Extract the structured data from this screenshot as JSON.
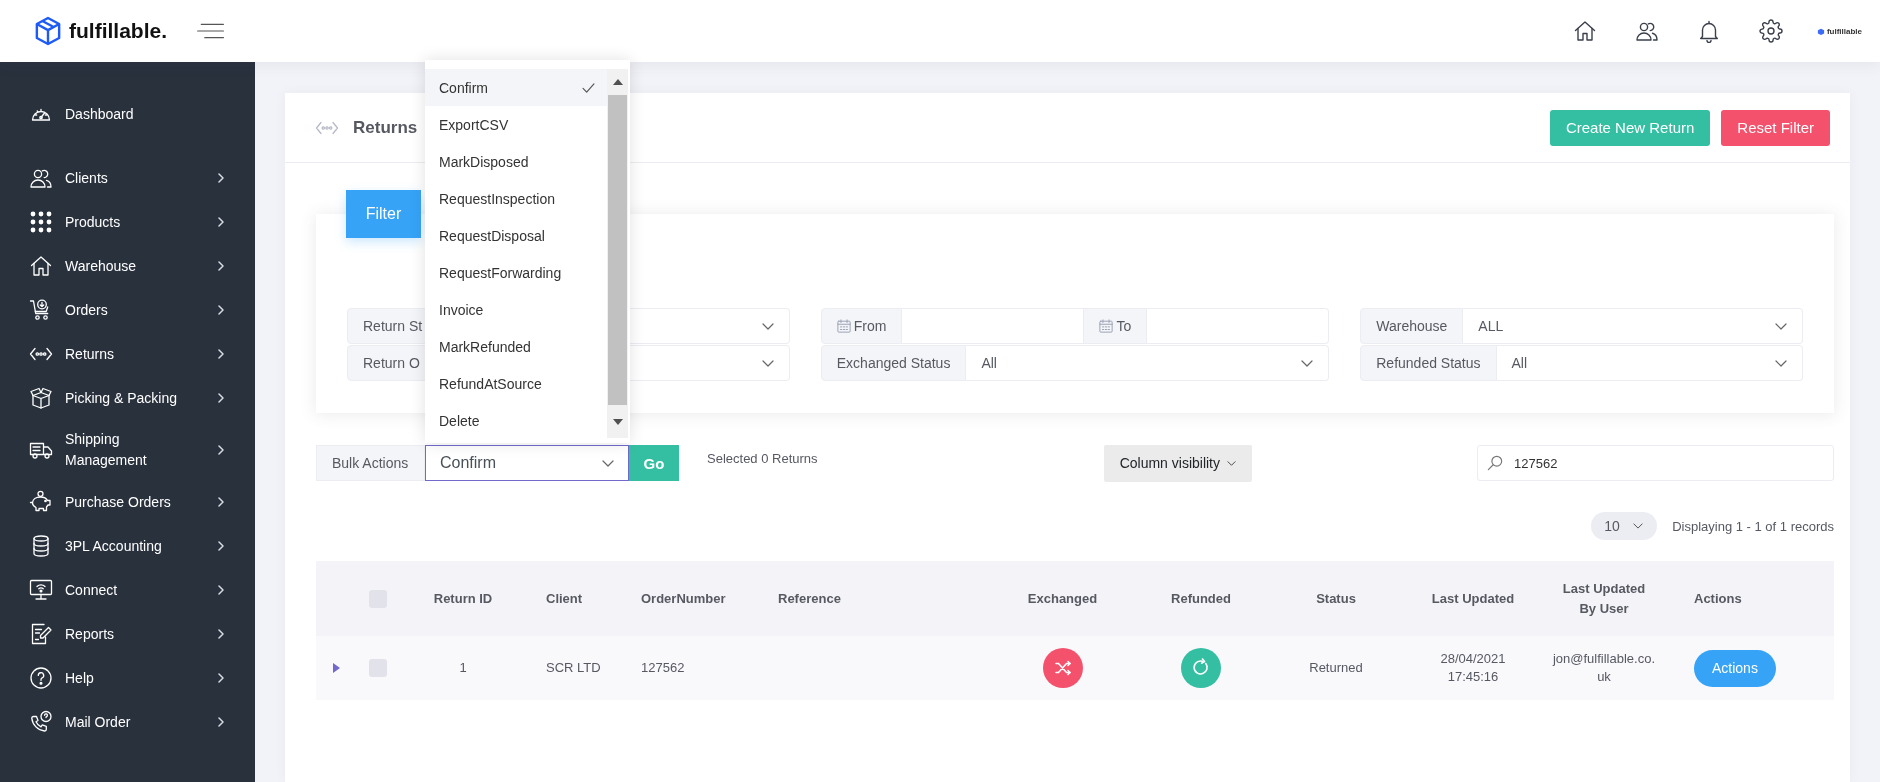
{
  "header": {
    "logo": "fulfillable.",
    "account_brand": "fulfillable"
  },
  "sidebar": {
    "items": [
      {
        "label": "Dashboard",
        "expandable": false
      },
      {
        "label": "Clients",
        "expandable": true
      },
      {
        "label": "Products",
        "expandable": true
      },
      {
        "label": "Warehouse",
        "expandable": true
      },
      {
        "label": "Orders",
        "expandable": true
      },
      {
        "label": "Returns",
        "expandable": true
      },
      {
        "label": "Picking & Packing",
        "expandable": true
      },
      {
        "label": "Shipping Management",
        "expandable": true
      },
      {
        "label": "Purchase Orders",
        "expandable": true
      },
      {
        "label": "3PL Accounting",
        "expandable": true
      },
      {
        "label": "Connect",
        "expandable": true
      },
      {
        "label": "Reports",
        "expandable": true
      },
      {
        "label": "Help",
        "expandable": true
      },
      {
        "label": "Mail Order",
        "expandable": true
      }
    ]
  },
  "page": {
    "title": "Returns",
    "create_button": "Create New Return",
    "reset_button": "Reset Filter"
  },
  "filter": {
    "tab": "Filter",
    "groups": [
      {
        "rows": [
          {
            "kind": "select",
            "label": "Return St"
          },
          {
            "kind": "select",
            "label": "Return O"
          }
        ]
      },
      {
        "rows": [
          {
            "kind": "date_range",
            "from_label": "From",
            "to_label": "To"
          },
          {
            "kind": "select",
            "label": "Exchanged Status",
            "value": "All"
          }
        ]
      },
      {
        "rows": [
          {
            "kind": "select",
            "label": "Warehouse",
            "value": "ALL"
          },
          {
            "kind": "select",
            "label": "Refunded Status",
            "value": "All"
          }
        ]
      }
    ]
  },
  "bulk_actions": {
    "label": "Bulk Actions",
    "value": "Confirm",
    "go_button": "Go",
    "open": true,
    "options": [
      {
        "label": "Confirm",
        "selected": true
      },
      {
        "label": "ExportCSV",
        "selected": false
      },
      {
        "label": "MarkDisposed",
        "selected": false
      },
      {
        "label": "RequestInspection",
        "selected": false
      },
      {
        "label": "RequestDisposal",
        "selected": false
      },
      {
        "label": "RequestForwarding",
        "selected": false
      },
      {
        "label": "Invoice",
        "selected": false
      },
      {
        "label": "MarkRefunded",
        "selected": false
      },
      {
        "label": "RefundAtSource",
        "selected": false
      },
      {
        "label": "Delete",
        "selected": false
      }
    ]
  },
  "selection_info": "Selected 0 Returns",
  "column_visibility": "Column visibility",
  "search": {
    "value": "127562"
  },
  "page_size": "10",
  "records_info": "Displaying 1 - 1 of 1 records",
  "table": {
    "select_all_checked": false,
    "columns": [
      "Return ID",
      "Client",
      "OrderNumber",
      "Reference",
      "Exchanged",
      "Refunded",
      "Status",
      "Last Updated",
      "Last Updated By User",
      "Actions"
    ],
    "rows": [
      {
        "expanded": false,
        "checked": false,
        "return_id": "1",
        "client": "SCR LTD",
        "order_number": "127562",
        "status": "Returned",
        "last_updated": "28/04/2021 17:45:16",
        "last_updated_by": "jon@fulfillable.co.uk",
        "action": "Actions"
      }
    ]
  }
}
